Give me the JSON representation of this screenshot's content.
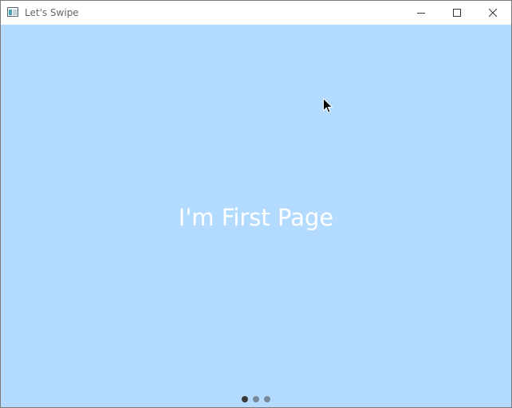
{
  "window": {
    "title": "Let's Swipe"
  },
  "titlebar": {
    "app_icon": "app-window-icon",
    "buttons": {
      "minimize_icon": "minimize-icon",
      "maximize_icon": "maximize-icon",
      "close_icon": "close-icon"
    }
  },
  "swipe_view": {
    "current_page_label": "I'm First Page",
    "page_count": 3,
    "current_index": 0,
    "background_color": "#b3dbff",
    "text_color": "#ffffff"
  },
  "cursor": {
    "icon": "arrow-pointer-icon"
  }
}
